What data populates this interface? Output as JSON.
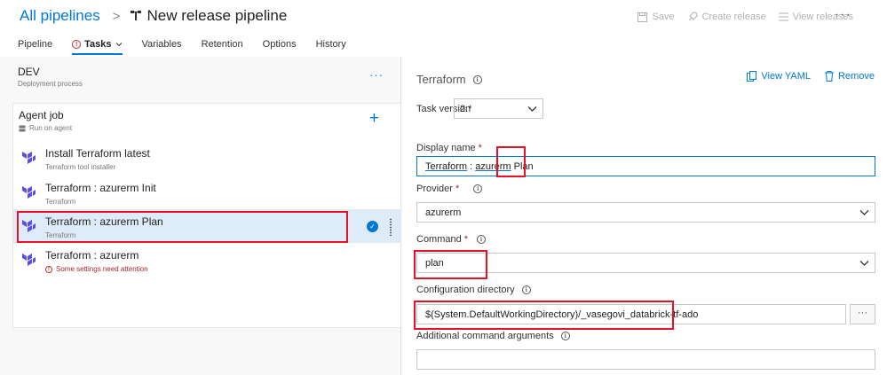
{
  "breadcrumb": {
    "root": "All pipelines",
    "separator": ">",
    "title": "New release pipeline"
  },
  "toolbar": {
    "save": "Save",
    "create_release": "Create release",
    "view_releases": "View releases",
    "more": "···"
  },
  "tabs": [
    {
      "label": "Pipeline"
    },
    {
      "label": "Tasks",
      "warning": true,
      "active": true
    },
    {
      "label": "Variables"
    },
    {
      "label": "Retention"
    },
    {
      "label": "Options"
    },
    {
      "label": "History"
    }
  ],
  "stage": {
    "name": "DEV",
    "subtitle": "Deployment process",
    "more": "···"
  },
  "job": {
    "title": "Agent job",
    "subtitle": "Run on agent",
    "add": "+"
  },
  "tasks": [
    {
      "title": "Install Terraform latest",
      "subtitle": "Terraform tool installer"
    },
    {
      "title": "Terraform : azurerm Init",
      "subtitle": "Terraform"
    },
    {
      "title": "Terraform : azurerm Plan",
      "subtitle": "Terraform",
      "selected": true
    },
    {
      "title": "Terraform : azurerm",
      "subtitle": "Some settings need attention",
      "warning": true
    }
  ],
  "detail": {
    "title": "Terraform",
    "view_yaml": "View YAML",
    "remove": "Remove",
    "task_version_label": "Task version",
    "task_version": "2.*",
    "display_name_label": "Display name",
    "display_name_part1": "Terraform",
    "display_name_part2": " : ",
    "display_name_part3": "azurerm",
    "display_name_part4": " Plan",
    "provider_label": "Provider",
    "provider": "azurerm",
    "command_label": "Command",
    "command": "plan",
    "config_dir_label": "Configuration directory",
    "config_dir": "$(System.DefaultWorkingDirectory)/_vasegovi_databrick-tf-ado",
    "browse": "···",
    "additional_args_label": "Additional command arguments",
    "additional_args": "",
    "required_mark": "*"
  },
  "colors": {
    "accent": "#0078d4",
    "highlight": "#e81123",
    "terraform": "#5c4ee5",
    "warning": "#a4262c"
  }
}
